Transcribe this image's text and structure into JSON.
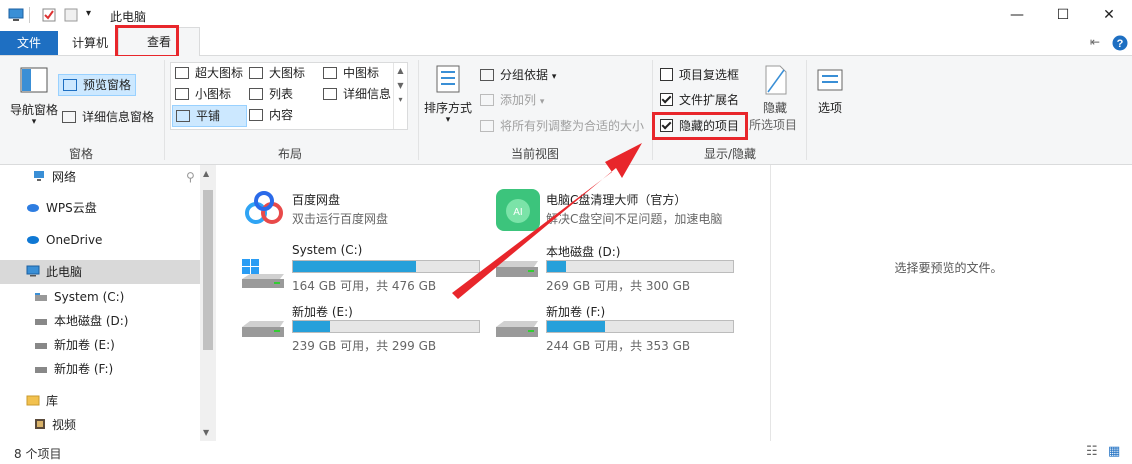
{
  "window": {
    "title": "此电脑",
    "controls": {
      "minimize": "—",
      "maximize": "☐",
      "close": "✕"
    }
  },
  "tabs": {
    "file": "文件",
    "computer": "计算机",
    "view": "查看"
  },
  "ribbon": {
    "panes": {
      "label": "窗格",
      "nav_pane": "导航窗格",
      "preview_pane": "预览窗格",
      "details_pane": "详细信息窗格"
    },
    "layout": {
      "label": "布局",
      "items": [
        "超大图标",
        "大图标",
        "中图标",
        "小图标",
        "列表",
        "详细信息",
        "平铺",
        "内容"
      ],
      "selected": "平铺"
    },
    "current_view": {
      "label": "当前视图",
      "sort": "排序方式",
      "group_by": "分组依据",
      "add_column": "添加列",
      "fit_columns": "将所有列调整为合适的大小"
    },
    "show_hide": {
      "label": "显示/隐藏",
      "item_checkboxes": {
        "label": "项目复选框",
        "checked": false
      },
      "file_extensions": {
        "label": "文件扩展名",
        "checked": true
      },
      "hidden_items": {
        "label": "隐藏的项目",
        "checked": true
      },
      "hide_selected_1": "隐藏",
      "hide_selected_2": "所选项目"
    },
    "options": "选项"
  },
  "nav": {
    "items": [
      {
        "label": "网络",
        "level": 0
      },
      {
        "label": "WPS云盘",
        "level": 0
      },
      {
        "label": "OneDrive",
        "level": 0
      },
      {
        "label": "此电脑",
        "level": 0,
        "selected": true
      },
      {
        "label": "System (C:)",
        "level": 1
      },
      {
        "label": "本地磁盘 (D:)",
        "level": 1
      },
      {
        "label": "新加卷 (E:)",
        "level": 1
      },
      {
        "label": "新加卷 (F:)",
        "level": 1
      },
      {
        "label": "库",
        "level": 0
      },
      {
        "label": "视频",
        "level": 1
      }
    ]
  },
  "content": {
    "apps": [
      {
        "name": "百度网盘",
        "desc": "双击运行百度网盘"
      },
      {
        "name": "电脑C盘清理大师（官方）",
        "desc": "解决C盘空间不足问题，加速电脑"
      }
    ],
    "drives": [
      {
        "name": "System (C:)",
        "info": "164 GB 可用，共 476 GB",
        "used": 0.66
      },
      {
        "name": "本地磁盘 (D:)",
        "info": "269 GB 可用，共 300 GB",
        "used": 0.1
      },
      {
        "name": "新加卷 (E:)",
        "info": "239 GB 可用，共 299 GB",
        "used": 0.2
      },
      {
        "name": "新加卷 (F:)",
        "info": "244 GB 可用，共 353 GB",
        "used": 0.31
      }
    ]
  },
  "preview": {
    "empty_text": "选择要预览的文件。"
  },
  "status": {
    "count": "8 个项目"
  },
  "colors": {
    "accent": "#1e6fc2",
    "bar": "#26a0da",
    "highlight": "#e8262b",
    "selected": "#cce8ff"
  }
}
